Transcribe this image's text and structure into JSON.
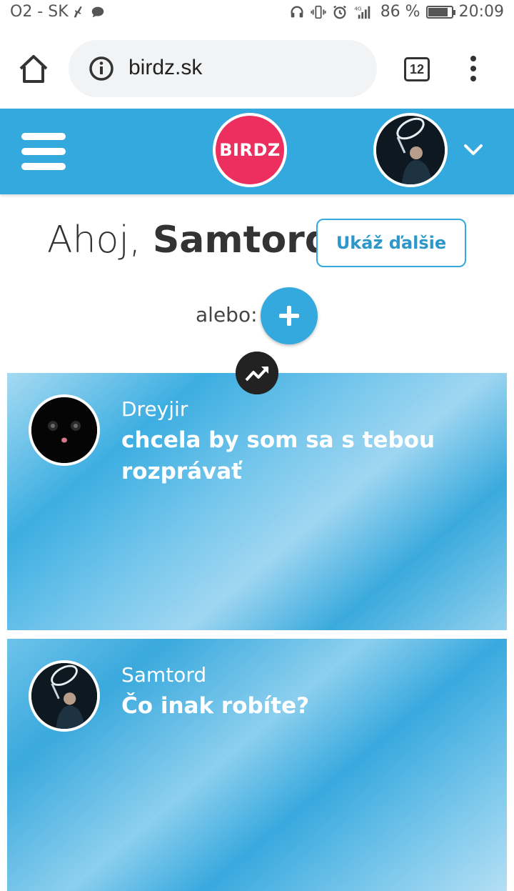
{
  "status_bar": {
    "carrier": "O2 - SK",
    "network": "4G",
    "battery_percent": "86 %",
    "battery_level": 0.86,
    "time": "20:09",
    "icons": [
      "broom-icon",
      "chat-bubble-icon",
      "headphones-icon",
      "vibrate-icon",
      "alarm-icon",
      "signal-icon",
      "battery-icon"
    ]
  },
  "browser": {
    "url": "birdz.sk",
    "tab_count": "12",
    "icons": [
      "home-icon",
      "info-icon",
      "tabs-icon",
      "more-vert-icon"
    ]
  },
  "header": {
    "logo_text": "BIRDZ",
    "brand_color": "#ec2f5f",
    "bar_color": "#34a9dd",
    "icons": [
      "hamburger-menu-icon",
      "user-avatar",
      "chevron-down-icon"
    ]
  },
  "greeting": {
    "prefix": "Ahoj, ",
    "username": "Samtord",
    "show_more_label": "Ukáž ďalšie",
    "or_label": "alebo:"
  },
  "feed": [
    {
      "author": "Dreyjir",
      "message": "chcela by som sa s tebou rozprávať",
      "avatar": "black-cat-avatar"
    },
    {
      "author": "Samtord",
      "message": "Čo inak robíte?",
      "avatar": "performer-avatar"
    }
  ]
}
